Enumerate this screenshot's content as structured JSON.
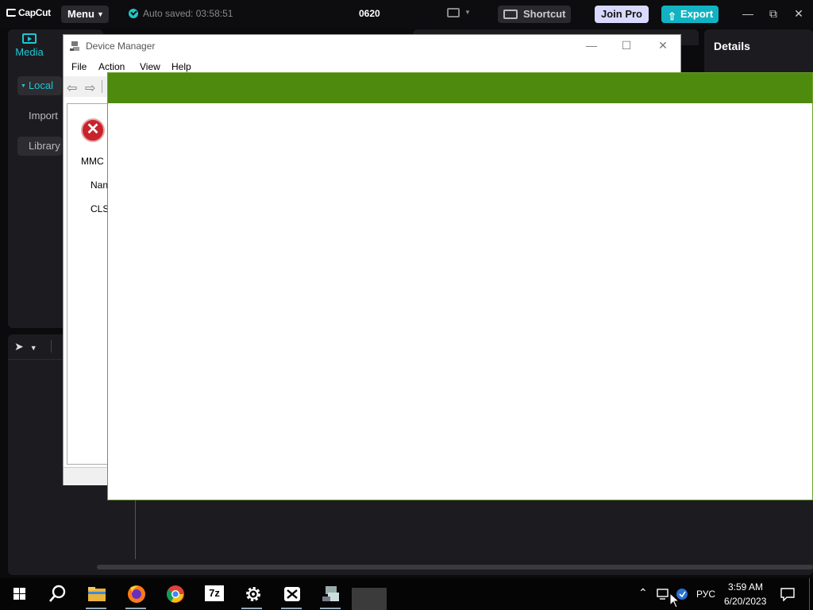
{
  "capcut": {
    "logo": "CapCut",
    "menu_label": "Menu",
    "autosave_text": "Auto saved: 03:58:51",
    "project_name": "0620",
    "shortcut_label": "Shortcut",
    "join_pro_label": "Join Pro",
    "export_label": "Export",
    "media_tab": "Media",
    "sidebar": {
      "local": "Local",
      "import": "Import",
      "library": "Library"
    },
    "details_title": "Details"
  },
  "device_manager": {
    "title": "Device Manager",
    "menu": [
      "File",
      "Action",
      "View",
      "Help"
    ],
    "error": {
      "line1": "MMC",
      "line2": "Nan",
      "line3": "CLS"
    }
  },
  "splash": {
    "bar_color": "#4e8a0e"
  },
  "taskbar": {
    "apps": [
      "start-icon",
      "search-icon",
      "file-explorer-icon",
      "firefox-icon",
      "chrome-icon",
      "7zip-icon",
      "settings-icon",
      "capcut-icon",
      "device-manager-icon"
    ],
    "sevenzip_label": "7z",
    "language": "РУС",
    "time": "3:59 AM",
    "date": "6/20/2023"
  },
  "colors": {
    "accent_teal": "#1fc7d6",
    "export_bg": "#11b3c2",
    "join_pro_bg": "#d9d9ff",
    "error_red": "#c8232c"
  }
}
